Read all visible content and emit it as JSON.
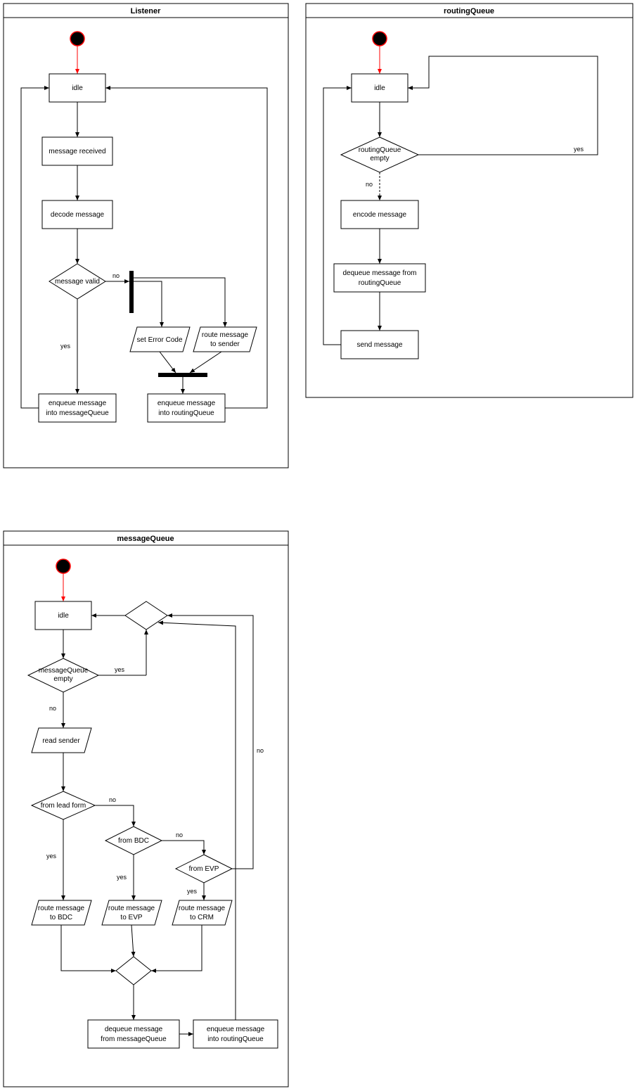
{
  "listener": {
    "title": "Listener",
    "idle": "idle",
    "message_received": "message received",
    "decode_message": "decode message",
    "message_valid": "message valid",
    "yes": "yes",
    "no": "no",
    "set_error_code": "set Error Code",
    "route_to_sender_l1": "route message",
    "route_to_sender_l2": "to sender",
    "enqueue_mq_l1": "enqueue message",
    "enqueue_mq_l2": "into messageQueue",
    "enqueue_rq_l1": "enqueue message",
    "enqueue_rq_l2": "into routingQueue"
  },
  "routingQueue": {
    "title": "routingQueue",
    "idle": "idle",
    "rq_empty_l1": "routingQueue",
    "rq_empty_l2": "empty",
    "yes": "yes",
    "no": "no",
    "encode_message": "encode message",
    "dequeue_l1": "dequeue message from",
    "dequeue_l2": "routingQueue",
    "send_message": "send message"
  },
  "messageQueue": {
    "title": "messageQueue",
    "idle": "idle",
    "mq_empty_l1": "messageQueue",
    "mq_empty_l2": "empty",
    "yes": "yes",
    "no": "no",
    "read_sender": "read sender",
    "from_lead_form": "from lead form",
    "from_bdc": "from BDC",
    "from_evp": "from EVP",
    "route_bdc_l1": "route message",
    "route_bdc_l2": "to BDC",
    "route_evp_l1": "route message",
    "route_evp_l2": "to EVP",
    "route_crm_l1": "route message",
    "route_crm_l2": "to CRM",
    "dequeue_mq_l1": "dequeue message",
    "dequeue_mq_l2": "from messageQueue",
    "enqueue_rq_l1": "enqueue message",
    "enqueue_rq_l2": "into routingQueue"
  }
}
